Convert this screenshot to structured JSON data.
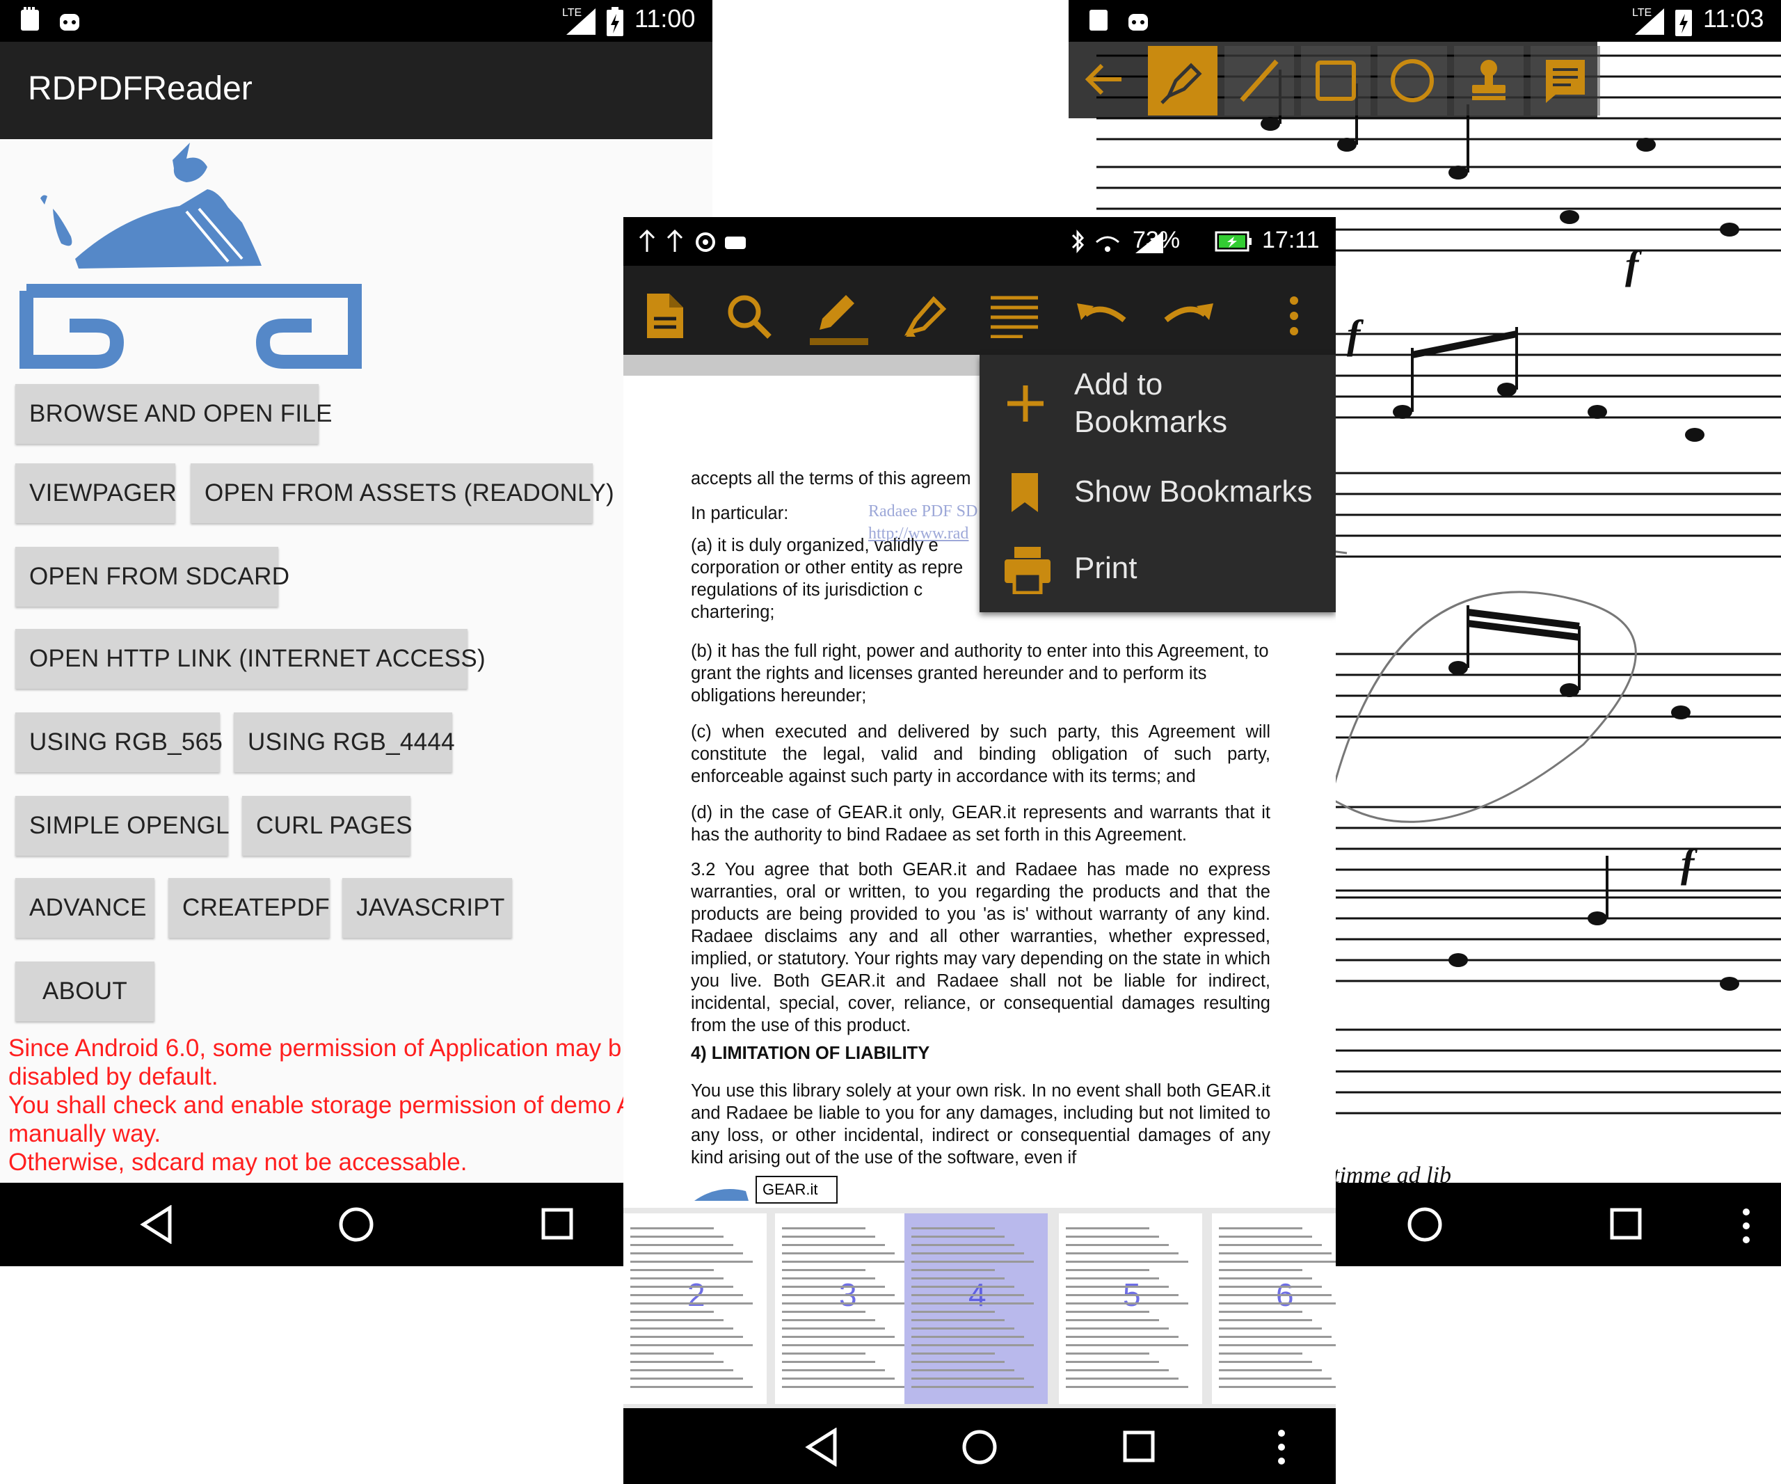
{
  "left_phone": {
    "status_time": "11:00",
    "status_network": "LTE",
    "app_title": "RDPDFReader",
    "buttons": [
      "BROWSE AND OPEN FILE",
      "VIEWPAGER",
      "OPEN FROM ASSETS (READONLY)",
      "OPEN FROM SDCARD",
      "OPEN HTTP LINK (INTERNET ACCESS)",
      "USING RGB_565",
      "USING RGB_4444",
      "SIMPLE OPENGL",
      "CURL PAGES",
      "ADVANCE",
      "CREATEPDF",
      "JAVASCRIPT",
      "ABOUT"
    ],
    "warning_lines": [
      "Since Android 6.0, some permission of Application may b",
      "disabled by default.",
      "You shall check and enable storage permission of demo A",
      "manually way.",
      "Otherwise, sdcard may not be accessable."
    ],
    "warning_color": "#ff1f1f"
  },
  "middle_phone": {
    "status_battery": "73%",
    "status_time": "17:11",
    "toolbar_icons": [
      "document-icon",
      "search-icon",
      "pencil-icon",
      "highlighter-icon",
      "align-icon",
      "undo-icon",
      "redo-icon",
      "overflow-menu-icon"
    ],
    "accent_color": "#c98a10",
    "menu": {
      "add_bookmarks_line1": "Add to",
      "add_bookmarks_line2": "Bookmarks",
      "show_bookmarks": "Show Bookmarks",
      "print": "Print"
    },
    "document": {
      "lines_top": [
        "accepts all the terms of this agreem",
        "In particular:"
      ],
      "watermark_1": "Radaee PDF SD",
      "watermark_2": "http://www.rad",
      "para_a": [
        "(a)   it is duly organized, validly e",
        "corporation or other entity as repre",
        "regulations   of   its   jurisdiction   c",
        "chartering;"
      ],
      "para_b": "(b)   it has the full right, power and authority to enter into this Agreement, to grant the rights and licenses granted hereunder and to perform its obligations hereunder;",
      "para_c": "(c) when executed and delivered by such party, this Agreement will constitute the legal, valid and binding obligation of such party, enforceable against such party in accordance with its terms; and",
      "para_d": "(d) in the case of GEAR.it only, GEAR.it represents and warrants that it has the authority to bind Radaee as set forth in this Agreement.",
      "para_32": "3.2 You agree that both GEAR.it and Radaee has made no express warranties, oral or written, to you regarding the products and that the products are being provided to you 'as is' without warranty of any kind. Radaee disclaims any and all other warranties, whether expressed, implied, or statutory. Your rights may vary depending on the state in which you live. Both GEAR.it and Radaee shall not be liable for indirect, incidental, special, cover, reliance, or consequential damages resulting from the use of this product.",
      "heading_4": "4) LIMITATION OF LIABILITY",
      "para_4": "You use this library solely at your own risk. In no event shall both GEAR.it and Radaee be liable to you for any damages, including but not limited to any loss, or other incidental, indirect or consequential damages of any kind arising out of the use of the software, even if",
      "footer_logo_text": "GEAR.it"
    },
    "thumbnails": [
      "2",
      "3",
      "4",
      "5",
      "6"
    ],
    "selected_thumbnail": "4"
  },
  "right_phone": {
    "status_time": "11:03",
    "status_network": "LTE",
    "annotation_tools": [
      "back-arrow-icon",
      "ink-pen-icon",
      "line-icon",
      "rectangle-icon",
      "ellipse-icon",
      "stamp-icon",
      "note-icon"
    ],
    "score_caption": "timme ad lib",
    "dynamic_marks": [
      "f",
      "f",
      "f"
    ]
  }
}
